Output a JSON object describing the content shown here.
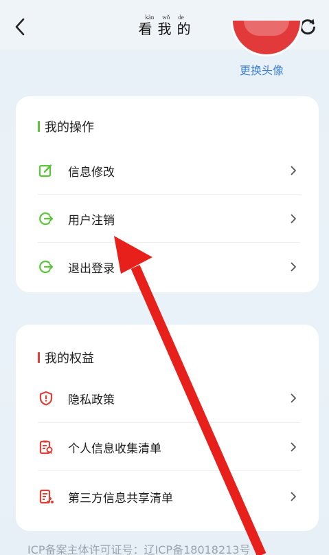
{
  "header": {
    "title": "看我的",
    "title_pinyin": [
      "kàn",
      "wǒ",
      "de"
    ],
    "back_icon": "chevron-left-icon",
    "refresh_icon": "refresh-icon"
  },
  "profile": {
    "change_avatar_label": "更换头像"
  },
  "my_operations": {
    "title": "我的操作",
    "accent_color": "#5cc33a",
    "items": [
      {
        "label": "信息修改",
        "icon": "edit-icon"
      },
      {
        "label": "用户注销",
        "icon": "logout-icon"
      },
      {
        "label": "退出登录",
        "icon": "logout-icon"
      }
    ]
  },
  "my_rights": {
    "title": "我的权益",
    "accent_color": "#e0403a",
    "items": [
      {
        "label": "隐私政策",
        "icon": "shield-icon"
      },
      {
        "label": "个人信息收集清单",
        "icon": "clipboard-icon"
      },
      {
        "label": "第三方信息共享清单",
        "icon": "share-list-icon"
      }
    ]
  },
  "footer": {
    "icp_text": "ICP备案主体许可证号：辽ICP备18018213号"
  },
  "overlay": {
    "arrow_color": "#e8201c"
  }
}
